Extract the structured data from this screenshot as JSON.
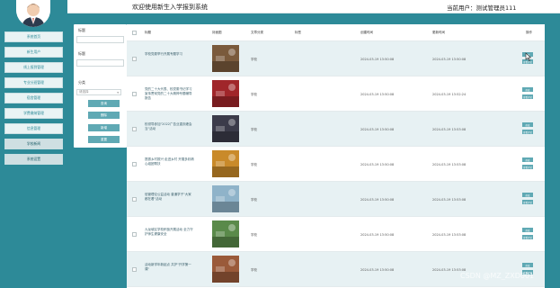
{
  "header": {
    "title": "欢迎使用新生入学报到系统",
    "user": "当前用户：测试管理员111"
  },
  "sidebar": {
    "items": [
      {
        "label": "系统首页"
      },
      {
        "label": "新生用户"
      },
      {
        "label": "线上报到管理"
      },
      {
        "label": "专业分班管理"
      },
      {
        "label": "宿舍管理"
      },
      {
        "label": "学费缴纳管理"
      },
      {
        "label": "信息管理"
      },
      {
        "label": "学校新闻"
      },
      {
        "label": "系统设置"
      }
    ]
  },
  "filter": {
    "label_title": "标题",
    "label_content": "标题",
    "label_category": "分类",
    "select_placeholder": "请选择",
    "btn_search": "查询",
    "btn_delete": "删除",
    "btn_add": "新增",
    "btn_reset": "重置"
  },
  "table": {
    "headers": {
      "title": "标题",
      "image": "封面图",
      "category": "文章分类",
      "tags": "标签",
      "created": "创建时间",
      "updated": "更新时间",
      "actions": "操作"
    },
    "rows": [
      {
        "title": "学校党委举行开展专题学习",
        "category": "学校",
        "tags": "",
        "created": "2024-03-19 13:50:08",
        "updated": "2024-03-19 13:50:08",
        "thumb_color": "#7a5a3c"
      },
      {
        "title": "党的二十大代表、校党委书记学习宣传贯彻党的二十大精神专题辅导报告",
        "category": "学校",
        "tags": "",
        "created": "2024-03-19 13:50:08",
        "updated": "2024-03-19 13:52:24",
        "thumb_color": "#a0262a"
      },
      {
        "title": "校领导参加\"2022广告业重庆峰会当\"活动",
        "category": "学校",
        "tags": "",
        "created": "2024-03-19 13:50:08",
        "updated": "2024-03-19 13:53:08",
        "thumb_color": "#3b3b4a"
      },
      {
        "title": "提振乡村振兴·走进乡村 开展多彩精心组团帮扶",
        "category": "学校",
        "tags": "",
        "created": "2024-03-19 13:50:08",
        "updated": "2024-03-19 13:53:08",
        "thumb_color": "#c98a2a"
      },
      {
        "title": "信管理论公益活动 普通学子\"大家都在看\"活动",
        "category": "学校",
        "tags": "",
        "created": "2024-03-19 13:50:08",
        "updated": "2024-03-19 13:53:08",
        "thumb_color": "#8fb3c9"
      },
      {
        "title": "九龙坡区学校积极开展活动 全力守护师生健康安全",
        "category": "学校",
        "tags": "",
        "created": "2024-03-19 13:50:08",
        "updated": "2024-03-19 13:53:08",
        "thumb_color": "#5a8a4a"
      },
      {
        "title": "活动新学年新起点 共护\"开学第一课\"",
        "category": "学校",
        "tags": "",
        "created": "2024-03-19 13:50:08",
        "updated": "2024-03-19 13:53:08",
        "thumb_color": "#9a5a3a"
      }
    ],
    "btn_edit": "修改",
    "btn_detail": "查看评论"
  },
  "watermark": "CSDN @MZ_ZXD001"
}
